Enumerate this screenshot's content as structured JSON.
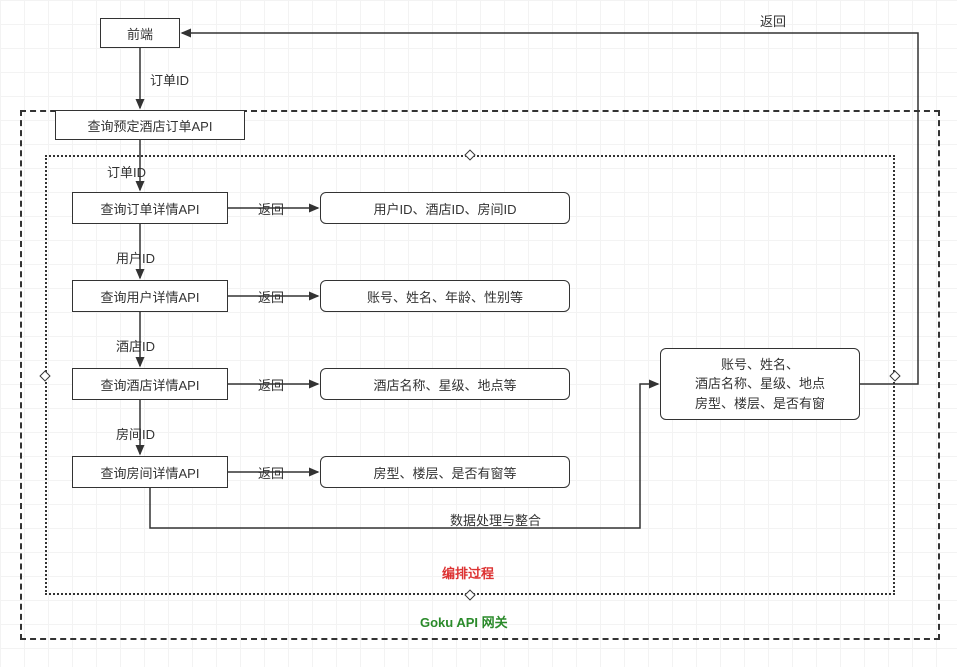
{
  "nodes": {
    "frontend": "前端",
    "queryOrderAPI": "查询预定酒店订单API",
    "queryOrderDetailAPI": "查询订单详情API",
    "queryUserDetailAPI": "查询用户详情API",
    "queryHotelDetailAPI": "查询酒店详情API",
    "queryRoomDetailAPI": "查询房间详情API",
    "orderDetailResult": "用户ID、酒店ID、房间ID",
    "userDetailResult": "账号、姓名、年龄、性别等",
    "hotelDetailResult": "酒店名称、星级、地点等",
    "roomDetailResult": "房型、楼层、是否有窗等",
    "aggregatedLine1": "账号、姓名、",
    "aggregatedLine2": "酒店名称、星级、地点",
    "aggregatedLine3": "房型、楼层、是否有窗"
  },
  "edges": {
    "orderId": "订单ID",
    "orderId2": "订单ID",
    "userId": "用户ID",
    "hotelId": "酒店ID",
    "roomId": "房间ID",
    "return": "返回",
    "aggregate": "数据处理与整合"
  },
  "captions": {
    "orchestration": "编排过程",
    "gateway": "Goku API 网关"
  }
}
